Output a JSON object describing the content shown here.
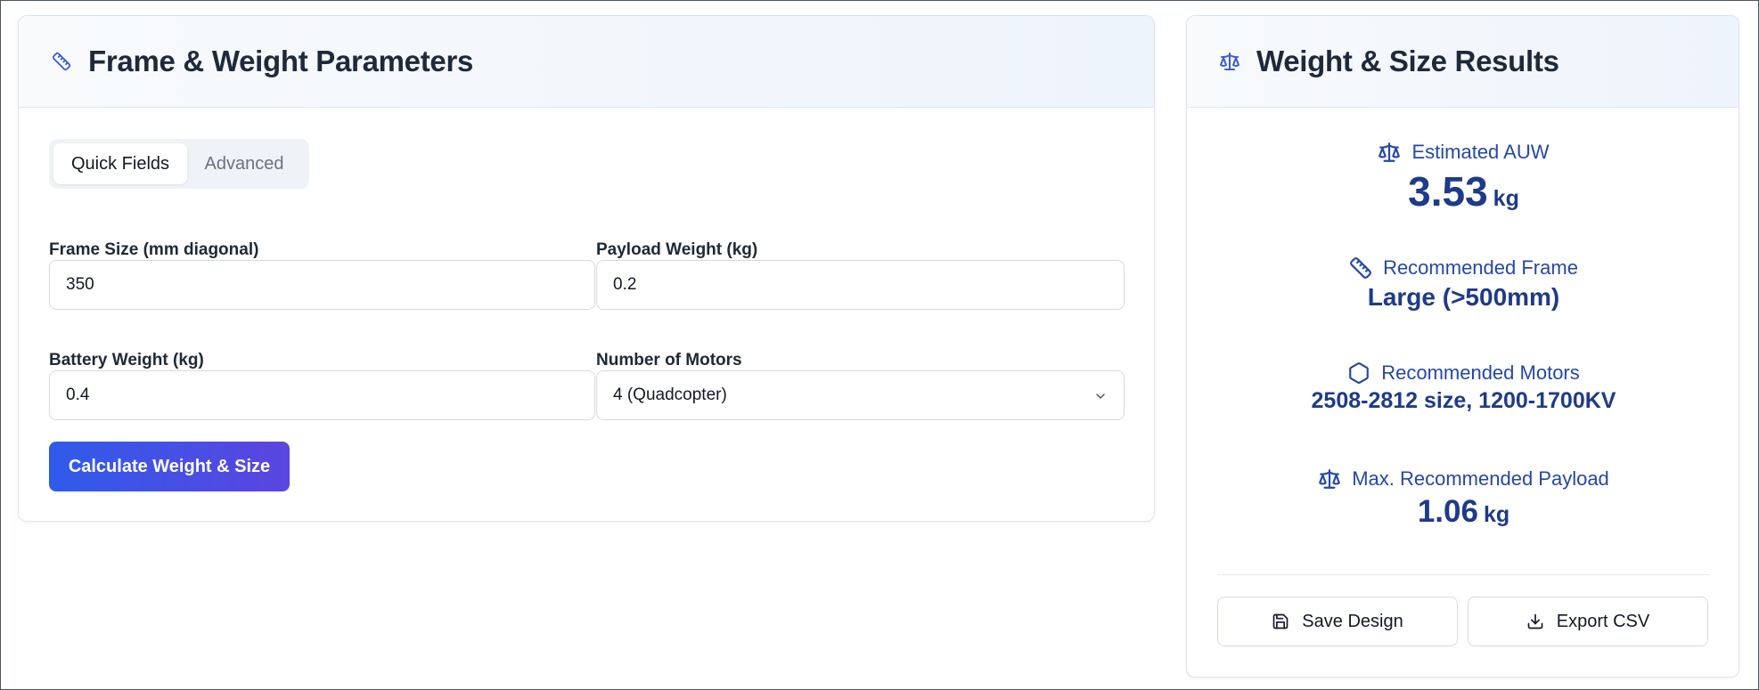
{
  "params_card": {
    "title": "Frame & Weight Parameters",
    "tabs": [
      {
        "label": "Quick Fields",
        "active": true
      },
      {
        "label": "Advanced",
        "active": false
      }
    ],
    "fields": {
      "frame_size": {
        "label": "Frame Size (mm diagonal)",
        "value": "350"
      },
      "payload_weight": {
        "label": "Payload Weight (kg)",
        "value": "0.2"
      },
      "battery_weight": {
        "label": "Battery Weight (kg)",
        "value": "0.4"
      },
      "motors": {
        "label": "Number of Motors",
        "value": "4 (Quadcopter)"
      }
    },
    "calculate_label": "Calculate Weight & Size"
  },
  "results_card": {
    "title": "Weight & Size Results",
    "auw": {
      "label": "Estimated AUW",
      "value": "3.53",
      "unit": "kg"
    },
    "frame": {
      "label": "Recommended Frame",
      "value": "Large (>500mm)"
    },
    "motors": {
      "label": "Recommended Motors",
      "value": "2508-2812 size, 1200-1700KV"
    },
    "payload": {
      "label": "Max. Recommended Payload",
      "value": "1.06",
      "unit": "kg"
    },
    "save_label": "Save Design",
    "export_label": "Export CSV"
  },
  "icons": {
    "header_params": "ruler-icon",
    "header_results": "scale-icon",
    "auw": "scale-icon",
    "frame": "ruler-icon",
    "motors": "hexagon-icon",
    "payload": "scale-icon",
    "save": "save-icon",
    "export": "download-icon",
    "select": "chevron-down-icon"
  },
  "colors": {
    "accent": "#2f5bea",
    "accent_end": "#5b45e0",
    "result_text": "#1e3a8a",
    "result_label": "#2447a8"
  }
}
